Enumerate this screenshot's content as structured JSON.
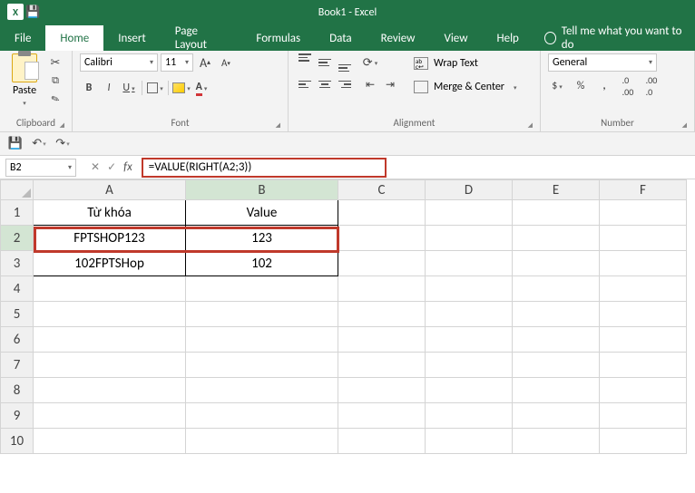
{
  "title": "Book1 - Excel",
  "tabs": [
    "File",
    "Home",
    "Insert",
    "Page Layout",
    "Formulas",
    "Data",
    "Review",
    "View",
    "Help"
  ],
  "tell_me": "Tell me what you want to do",
  "ribbon": {
    "clipboard": {
      "paste": "Paste",
      "label": "Clipboard"
    },
    "font": {
      "name": "Calibri",
      "size": "11",
      "label": "Font"
    },
    "alignment": {
      "wrap": "Wrap Text",
      "merge": "Merge & Center",
      "label": "Alignment"
    },
    "number": {
      "format": "General",
      "label": "Number"
    }
  },
  "name_box": "B2",
  "formula": "=VALUE(RIGHT(A2;3))",
  "columns": [
    "A",
    "B",
    "C",
    "D",
    "E",
    "F"
  ],
  "rows": [
    "1",
    "2",
    "3",
    "4",
    "5",
    "6",
    "7",
    "8",
    "9",
    "10"
  ],
  "sheet": {
    "A1": "Từ khóa",
    "B1": "Value",
    "A2": "FPTSHOP123",
    "B2": "123",
    "A3": "102FPTSHop",
    "B3": "102"
  }
}
